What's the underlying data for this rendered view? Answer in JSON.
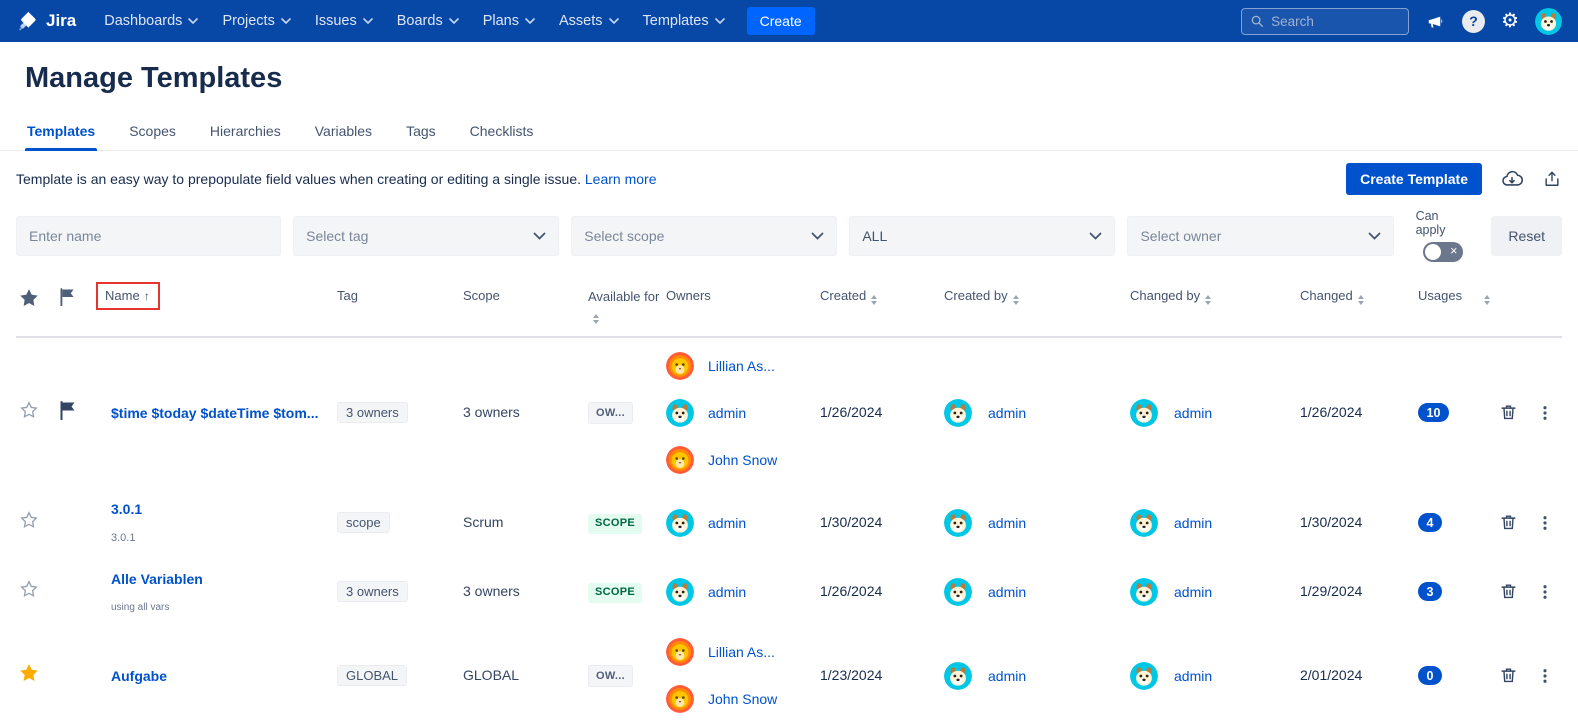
{
  "nav": {
    "brand": "Jira",
    "items": [
      "Dashboards",
      "Projects",
      "Issues",
      "Boards",
      "Plans",
      "Assets",
      "Templates"
    ],
    "create_label": "Create",
    "search_placeholder": "Search",
    "user_avatar": "dog"
  },
  "page": {
    "title": "Manage Templates",
    "tabs": [
      "Templates",
      "Scopes",
      "Hierarchies",
      "Variables",
      "Tags",
      "Checklists"
    ],
    "active_tab": "Templates",
    "description": "Template is an easy way to prepopulate field values when creating or editing a single issue.",
    "learn_more_label": "Learn more",
    "create_template_label": "Create Template"
  },
  "filters": {
    "name_placeholder": "Enter name",
    "tag_value": "Select tag",
    "scope_value": "Select scope",
    "available_value": "ALL",
    "owner_value": "Select owner",
    "can_apply_label": "Can apply",
    "toggle_state": "off",
    "reset_label": "Reset"
  },
  "table": {
    "headers": {
      "name": "Name",
      "tag": "Tag",
      "scope": "Scope",
      "available_for": "Available for",
      "owners": "Owners",
      "created": "Created",
      "created_by": "Created by",
      "changed_by": "Changed by",
      "changed": "Changed",
      "usages": "Usages"
    },
    "rows": [
      {
        "starred": false,
        "flagged": true,
        "name": "$time $today $dateTime $tom...",
        "subtitle": "",
        "tag": "3 owners",
        "scope": "3 owners",
        "available_for": "OW...",
        "available_style": "neutral",
        "owners": [
          {
            "name": "Lillian As...",
            "avatar": "lion"
          },
          {
            "name": "admin",
            "avatar": "dog"
          },
          {
            "name": "John Snow",
            "avatar": "lion"
          }
        ],
        "created": "1/26/2024",
        "created_by": {
          "name": "admin",
          "avatar": "dog"
        },
        "changed_by": {
          "name": "admin",
          "avatar": "dog"
        },
        "changed": "1/26/2024",
        "usages": "10"
      },
      {
        "starred": false,
        "flagged": false,
        "name": "3.0.1",
        "subtitle": "3.0.1",
        "tag": "scope",
        "scope": "Scrum",
        "available_for": "SCOPE",
        "available_style": "green",
        "owners": [
          {
            "name": "admin",
            "avatar": "dog"
          }
        ],
        "created": "1/30/2024",
        "created_by": {
          "name": "admin",
          "avatar": "dog"
        },
        "changed_by": {
          "name": "admin",
          "avatar": "dog"
        },
        "changed": "1/30/2024",
        "usages": "4"
      },
      {
        "starred": false,
        "flagged": false,
        "name": "Alle Variablen",
        "subtitle": "using all vars",
        "tag": "3 owners",
        "scope": "3 owners",
        "available_for": "SCOPE",
        "available_style": "green",
        "owners": [
          {
            "name": "admin",
            "avatar": "dog"
          }
        ],
        "created": "1/26/2024",
        "created_by": {
          "name": "admin",
          "avatar": "dog"
        },
        "changed_by": {
          "name": "admin",
          "avatar": "dog"
        },
        "changed": "1/29/2024",
        "usages": "3"
      },
      {
        "starred": true,
        "flagged": false,
        "name": "Aufgabe",
        "subtitle": "",
        "tag": "GLOBAL",
        "scope": "GLOBAL",
        "available_for": "OW...",
        "available_style": "neutral",
        "owners": [
          {
            "name": "Lillian As...",
            "avatar": "lion"
          },
          {
            "name": "John Snow",
            "avatar": "lion"
          }
        ],
        "created": "1/23/2024",
        "created_by": {
          "name": "admin",
          "avatar": "dog"
        },
        "changed_by": {
          "name": "admin",
          "avatar": "dog"
        },
        "changed": "2/01/2024",
        "usages": "0"
      }
    ]
  },
  "colors": {
    "nav_bg": "#0747A6",
    "accent": "#0052CC",
    "create_button": "#0065FF",
    "star_active": "#FFAB00",
    "annotation_red": "#E5342B",
    "badge_green_bg": "#E3FCEF",
    "badge_green_text": "#006644",
    "usages_pill": "#0052CC"
  }
}
